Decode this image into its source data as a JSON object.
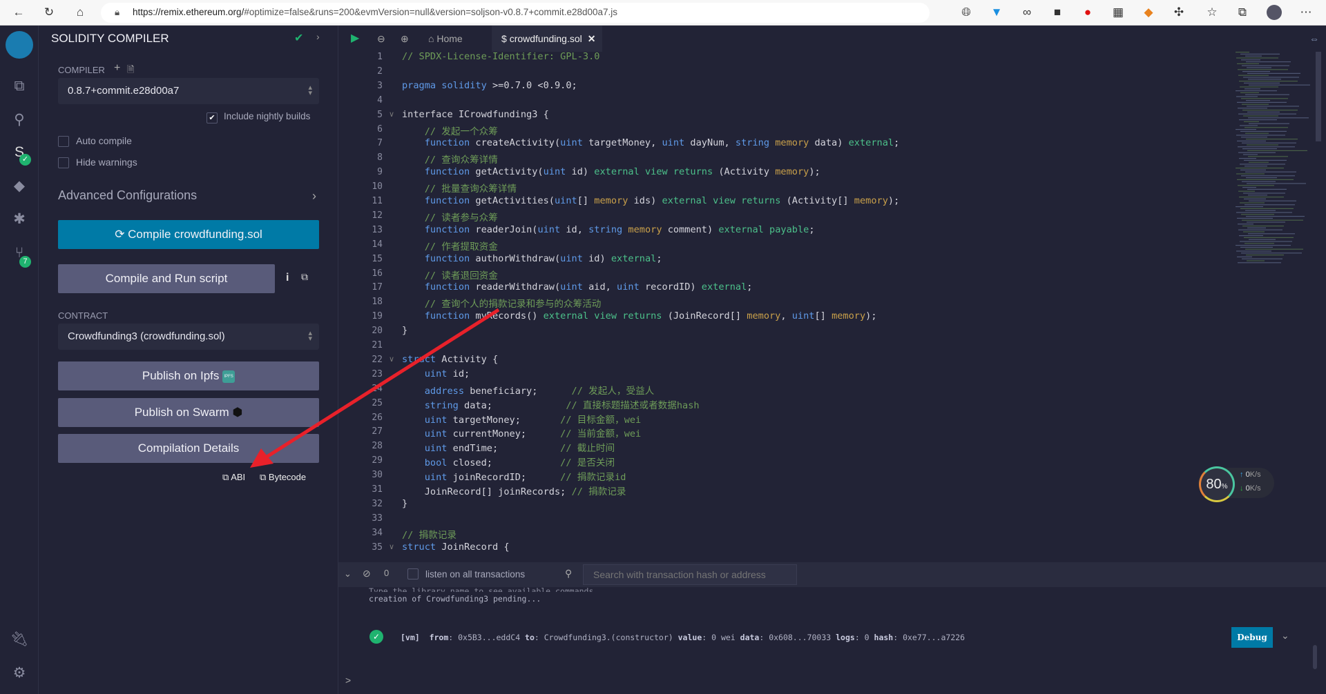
{
  "browser": {
    "url_host": "https://remix.ethereum.org/",
    "url_rest": "#optimize=false&runs=200&evmVersion=null&version=soljson-v0.8.7+commit.e28d00a7.js"
  },
  "panel": {
    "title": "SOLIDITY COMPILER",
    "compiler_label": "COMPILER",
    "compiler_version": "0.8.7+commit.e28d00a7",
    "nightly_label": "Include nightly builds",
    "nightly_checked": true,
    "auto_compile": "Auto compile",
    "hide_warnings": "Hide warnings",
    "advanced": "Advanced Configurations",
    "compile_btn": "Compile crowdfunding.sol",
    "run_script_btn": "Compile and Run script",
    "contract_label": "CONTRACT",
    "contract_value": "Crowdfunding3 (crowdfunding.sol)",
    "ipfs_btn": "Publish on Ipfs",
    "ipfs_badge": "IPFS",
    "swarm_btn": "Publish on Swarm",
    "details_btn": "Compilation Details",
    "abi": "ABI",
    "bytecode": "Bytecode",
    "git_badge": "7",
    "accent": "#007aa6"
  },
  "editor": {
    "home_tab": "Home",
    "file_tab": "crowdfunding.sol",
    "lines": [
      [
        [
          "// SPDX-License-Identifier: GPL-3.0",
          "c"
        ]
      ],
      [],
      [
        [
          "pragma solidity ",
          "k"
        ],
        [
          ">=0.7.0 <0.9.0;",
          "n"
        ]
      ],
      [],
      [
        [
          "interface ICrowdfunding3 {",
          "n"
        ]
      ],
      [
        [
          "    // 发起一个众筹",
          "c"
        ]
      ],
      [
        [
          "    function ",
          "k"
        ],
        [
          "createActivity(",
          "n"
        ],
        [
          "uint ",
          "k"
        ],
        [
          "targetMoney, ",
          "n"
        ],
        [
          "uint ",
          "k"
        ],
        [
          "dayNum, ",
          "n"
        ],
        [
          "string ",
          "k"
        ],
        [
          "memory ",
          "m"
        ],
        [
          "data) ",
          "n"
        ],
        [
          "external",
          "g"
        ],
        [
          ";",
          "n"
        ]
      ],
      [
        [
          "    // 查询众筹详情",
          "c"
        ]
      ],
      [
        [
          "    function ",
          "k"
        ],
        [
          "getActivity(",
          "n"
        ],
        [
          "uint ",
          "k"
        ],
        [
          "id) ",
          "n"
        ],
        [
          "external view returns ",
          "g"
        ],
        [
          "(Activity ",
          "n"
        ],
        [
          "memory",
          "m"
        ],
        [
          ");",
          "n"
        ]
      ],
      [
        [
          "    // 批量查询众筹详情",
          "c"
        ]
      ],
      [
        [
          "    function ",
          "k"
        ],
        [
          "getActivities(",
          "n"
        ],
        [
          "uint",
          "k"
        ],
        [
          "[] ",
          "n"
        ],
        [
          "memory ",
          "m"
        ],
        [
          "ids) ",
          "n"
        ],
        [
          "external view returns ",
          "g"
        ],
        [
          "(Activity[] ",
          "n"
        ],
        [
          "memory",
          "m"
        ],
        [
          ");",
          "n"
        ]
      ],
      [
        [
          "    // 读者参与众筹",
          "c"
        ]
      ],
      [
        [
          "    function ",
          "k"
        ],
        [
          "readerJoin(",
          "n"
        ],
        [
          "uint ",
          "k"
        ],
        [
          "id, ",
          "n"
        ],
        [
          "string ",
          "k"
        ],
        [
          "memory ",
          "m"
        ],
        [
          "comment) ",
          "n"
        ],
        [
          "external payable",
          "g"
        ],
        [
          ";",
          "n"
        ]
      ],
      [
        [
          "    // 作者提取资金",
          "c"
        ]
      ],
      [
        [
          "    function ",
          "k"
        ],
        [
          "authorWithdraw(",
          "n"
        ],
        [
          "uint ",
          "k"
        ],
        [
          "id) ",
          "n"
        ],
        [
          "external",
          "g"
        ],
        [
          ";",
          "n"
        ]
      ],
      [
        [
          "    // 读者退回资金",
          "c"
        ]
      ],
      [
        [
          "    function ",
          "k"
        ],
        [
          "readerWithdraw(",
          "n"
        ],
        [
          "uint ",
          "k"
        ],
        [
          "aid, ",
          "n"
        ],
        [
          "uint ",
          "k"
        ],
        [
          "recordID) ",
          "n"
        ],
        [
          "external",
          "g"
        ],
        [
          ";",
          "n"
        ]
      ],
      [
        [
          "    // 查询个人的捐款记录和参与的众筹活动",
          "c"
        ]
      ],
      [
        [
          "    function ",
          "k"
        ],
        [
          "myRecords() ",
          "n"
        ],
        [
          "external view returns ",
          "g"
        ],
        [
          "(JoinRecord[] ",
          "n"
        ],
        [
          "memory",
          "m"
        ],
        [
          ", ",
          "n"
        ],
        [
          "uint",
          "k"
        ],
        [
          "[] ",
          "n"
        ],
        [
          "memory",
          "m"
        ],
        [
          ");",
          "n"
        ]
      ],
      [
        [
          "}",
          "n"
        ]
      ],
      [],
      [
        [
          "struct ",
          "k"
        ],
        [
          "Activity {",
          "n"
        ]
      ],
      [
        [
          "    uint ",
          "k"
        ],
        [
          "id;",
          "n"
        ]
      ],
      [
        [
          "    address ",
          "k"
        ],
        [
          "beneficiary;      ",
          "n"
        ],
        [
          "// 发起人，受益人",
          "c"
        ]
      ],
      [
        [
          "    string ",
          "k"
        ],
        [
          "data;             ",
          "n"
        ],
        [
          "// 直接标题描述或者数据hash",
          "c"
        ]
      ],
      [
        [
          "    uint ",
          "k"
        ],
        [
          "targetMoney;       ",
          "n"
        ],
        [
          "// 目标金额，wei",
          "c"
        ]
      ],
      [
        [
          "    uint ",
          "k"
        ],
        [
          "currentMoney;      ",
          "n"
        ],
        [
          "// 当前金额，wei",
          "c"
        ]
      ],
      [
        [
          "    uint ",
          "k"
        ],
        [
          "endTime;           ",
          "n"
        ],
        [
          "// 截止时间",
          "c"
        ]
      ],
      [
        [
          "    bool ",
          "k"
        ],
        [
          "closed;            ",
          "n"
        ],
        [
          "// 是否关闭",
          "c"
        ]
      ],
      [
        [
          "    uint ",
          "k"
        ],
        [
          "joinRecordID;      ",
          "n"
        ],
        [
          "// 捐款记录id",
          "c"
        ]
      ],
      [
        [
          "    JoinRecord[] joinRecords; ",
          "n"
        ],
        [
          "// 捐款记录",
          "c"
        ]
      ],
      [
        [
          "}",
          "n"
        ]
      ],
      [],
      [
        [
          "// 捐款记录",
          "c"
        ]
      ],
      [
        [
          "struct ",
          "k"
        ],
        [
          "JoinRecord {",
          "n"
        ]
      ]
    ],
    "fold_lines": [
      5,
      22,
      35
    ]
  },
  "terminal": {
    "count": "0",
    "listen": "listen on all transactions",
    "search_placeholder": "Search with transaction hash or address",
    "line1": "Type the library name to see available commands.",
    "line2": "creation of Crowdfunding3 pending...",
    "tx": [
      [
        "[vm]",
        "b"
      ],
      [
        "from",
        "b"
      ],
      [
        ": 0x5B3...eddC4 ",
        ""
      ],
      [
        "to",
        "b"
      ],
      [
        ": Crowdfunding3.(constructor) ",
        ""
      ],
      [
        "value",
        "b"
      ],
      [
        ": 0 wei ",
        ""
      ],
      [
        "data",
        "b"
      ],
      [
        ": 0x608...70033 ",
        ""
      ],
      [
        "logs",
        "b"
      ],
      [
        ": 0 ",
        ""
      ],
      [
        "hash",
        "b"
      ],
      [
        ": 0xe77...a7226",
        ""
      ]
    ],
    "debug": "Debug",
    "prompt": ">"
  },
  "net_widget": {
    "percent": "80",
    "unit": "%",
    "up": "0",
    "down": "0",
    "rate_unit": "K/s"
  }
}
